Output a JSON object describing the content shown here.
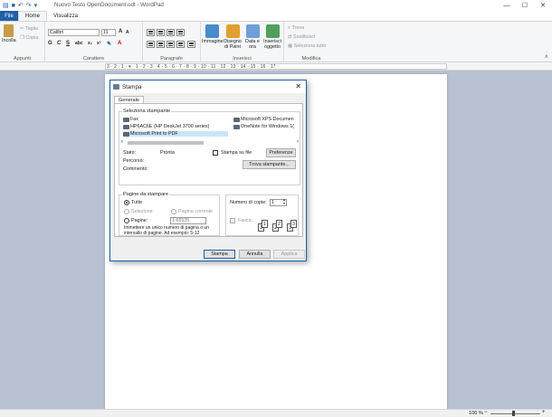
{
  "window": {
    "title": "Nuovo Testo OpenDocument.odt - WordPad"
  },
  "tabs": {
    "file": "File",
    "home": "Home",
    "view": "Visualizza"
  },
  "ribbon": {
    "appunti": {
      "label": "Appunti",
      "incolla": "Incolla",
      "taglia": "Taglia",
      "copia": "Copia"
    },
    "carattere": {
      "label": "Carattere",
      "font": "Calibri",
      "size": "11"
    },
    "paragrafo": {
      "label": "Paragrafo"
    },
    "inserisci": {
      "label": "Inserisci",
      "immagine": "Immagine",
      "paint": "Disegno di Paint",
      "data": "Data e ora",
      "oggetto": "Inserisci oggetto"
    },
    "modifica": {
      "label": "Modifica",
      "trova": "Trova",
      "sostituisci": "Sostituisci",
      "seleziona": "Seleziona tutto"
    }
  },
  "ruler": {
    "text": "3 · 2 · 1 · ▾ · 1 · 2 · 3 · 4 · 5 · 6 · 7 · 8 · 9 · 10 · 11 · 12 · 13 · 14 · 15 · 16 · 17 ·"
  },
  "status": {
    "zoom": "100 %",
    "minus": "−",
    "plus": "+"
  },
  "dialog": {
    "title": "Stampa",
    "tab": "Generale",
    "printers_label": "Seleziona stampante",
    "printers": [
      "Fax",
      "HP6AC6E (HP DeskJet 3700 series)",
      "Microsoft Print to PDF",
      "Microsoft XPS Documen",
      "OneNote for Windows 1("
    ],
    "stato_label": "Stato:",
    "stato_value": "Pronta",
    "percorso_label": "Percorso:",
    "commento_label": "Commento:",
    "stampa_su_file": "Stampa su file",
    "preferenze": "Preferenze",
    "trova_stampante": "Trova stampante...",
    "pagine_label": "Pagine da stampare",
    "tutte": "Tutte",
    "selezione": "Selezione",
    "pagina_corrente": "Pagina corrente",
    "pagine": "Pagine:",
    "pagine_value": "1-65535",
    "hint": "Immettere un unico numero di pagina o un intervallo di pagine. Ad esempio: 5-12",
    "copie_label": "Numero di copie:",
    "copie_value": "1",
    "fascic": "Fascic.",
    "pages_preview": [
      "1",
      "1",
      "2",
      "2",
      "3",
      "3"
    ],
    "stampa": "Stampa",
    "annulla": "Annulla",
    "applica": "Applica"
  }
}
